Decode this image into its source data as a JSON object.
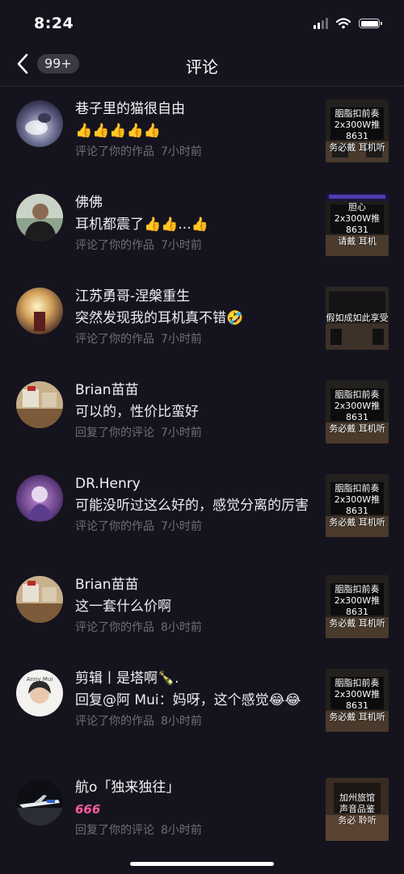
{
  "status": {
    "time": "8:24"
  },
  "nav": {
    "badge": "99+",
    "title": "评论"
  },
  "items": [
    {
      "name": "巷子里的猫很自由",
      "content": "",
      "action": "评论了你的作品",
      "time": "7小时前",
      "thumb_lines": [
        "胭脂扣前奏",
        "2x300W推8631",
        "务必戴   耳机听"
      ]
    },
    {
      "name": "佛佛",
      "content": "耳机都震了",
      "action": "评论了你的作品",
      "time": "7小时前",
      "thumb_lines": [
        "胆心",
        "2x300W推8631",
        "请戴   耳机"
      ]
    },
    {
      "name": "江苏勇哥-涅槃重生",
      "content": "突然发现我的耳机真不错",
      "action": "评论了你的作品",
      "time": "7小时前",
      "thumb_lines": [
        "假如成如此享受"
      ]
    },
    {
      "name": "Brian苗苗",
      "content": "可以的，性价比蛮好",
      "action": "回复了你的评论",
      "time": "7小时前",
      "thumb_lines": [
        "胭脂扣前奏",
        "2x300W推8631",
        "务必戴   耳机听"
      ]
    },
    {
      "name": "DR.Henry",
      "content": "可能没听过这么好的，感觉分离的厉害",
      "action": "评论了你的作品",
      "time": "7小时前",
      "thumb_lines": [
        "胭脂扣前奏",
        "2x300W推8631",
        "务必戴   耳机听"
      ]
    },
    {
      "name": "Brian苗苗",
      "content": "这一套什么价啊",
      "action": "评论了你的作品",
      "time": "8小时前",
      "thumb_lines": [
        "胭脂扣前奏",
        "2x300W推8631",
        "务必戴   耳机听"
      ]
    },
    {
      "name": "剪辑丨是塔啊",
      "content": "回复@阿 Mui：妈呀，这个感觉",
      "action": "评论了你的作品",
      "time": "8小时前",
      "thumb_lines": [
        "胭脂扣前奏",
        "2x300W推8631",
        "务必戴   耳机听"
      ]
    },
    {
      "name": "航ο「独来独往」",
      "content": "666",
      "action": "回复了你的评论",
      "time": "8小时前",
      "thumb_lines": [
        "加州旅馆",
        "声音品鉴",
        "务必   聆听"
      ]
    }
  ]
}
